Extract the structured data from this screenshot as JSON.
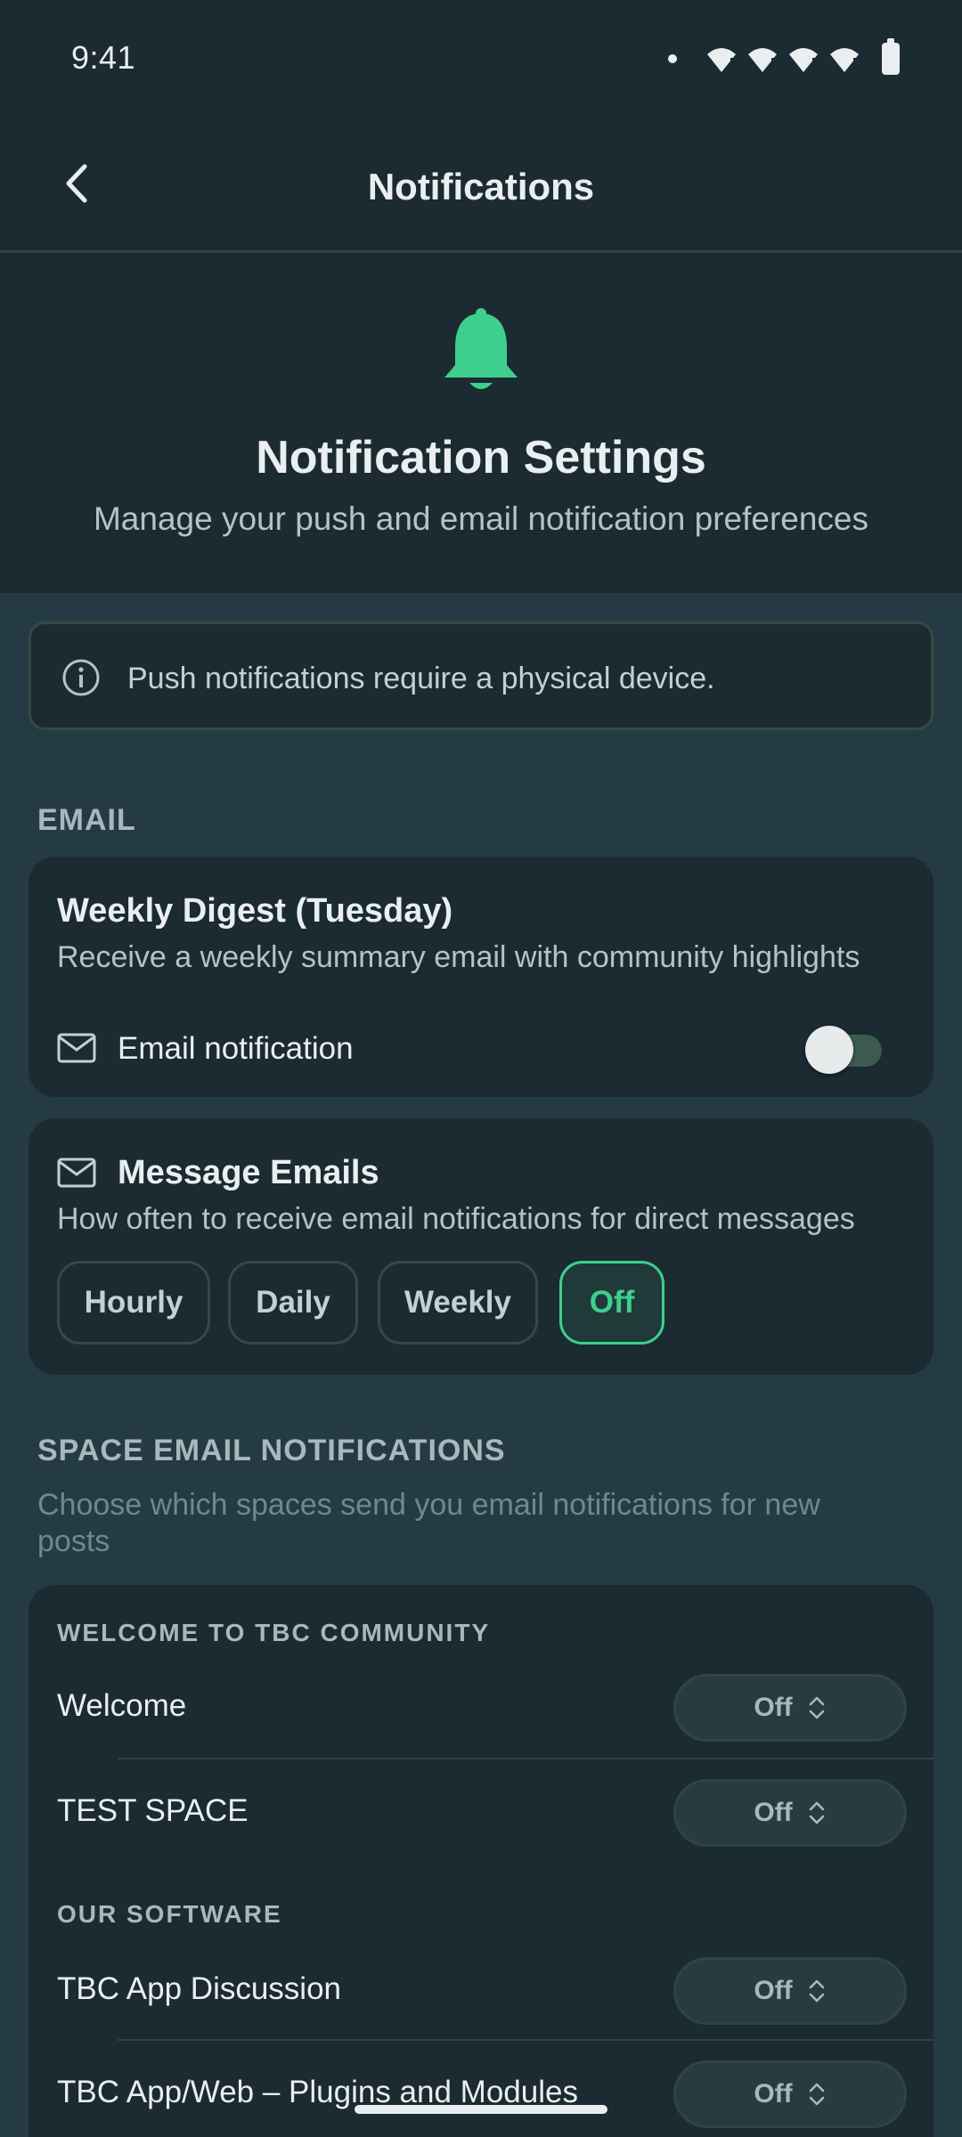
{
  "status_bar": {
    "time": "9:41"
  },
  "app_bar": {
    "title": "Notifications"
  },
  "hero": {
    "title": "Notification Settings",
    "subtitle": "Manage your push and email notification preferences"
  },
  "info_banner": {
    "text": "Push notifications require a physical device."
  },
  "email_section": {
    "header": "EMAIL",
    "weekly_digest": {
      "title": "Weekly Digest (Tuesday)",
      "description": "Receive a weekly summary email with community highlights",
      "toggle_label": "Email notification",
      "toggle_on": false
    },
    "message_emails": {
      "title": "Message Emails",
      "description": "How often to receive email notifications for direct messages",
      "options": [
        "Hourly",
        "Daily",
        "Weekly",
        "Off"
      ],
      "selected": "Off"
    }
  },
  "space_section": {
    "header": "SPACE EMAIL NOTIFICATIONS",
    "description": "Choose which spaces send you email notifications for new posts",
    "groups": [
      {
        "title": "WELCOME TO TBC COMMUNITY",
        "spaces": [
          {
            "name": "Welcome",
            "value": "Off"
          },
          {
            "name": "TEST SPACE",
            "value": "Off"
          }
        ]
      },
      {
        "title": "OUR SOFTWARE",
        "spaces": [
          {
            "name": "TBC App Discussion",
            "value": "Off"
          },
          {
            "name": "TBC App/Web – Plugins and Modules",
            "value": "Off"
          }
        ]
      }
    ]
  },
  "colors": {
    "background": "#1c2a31",
    "content_background": "#253b44",
    "accent": "#3ecf8e"
  }
}
